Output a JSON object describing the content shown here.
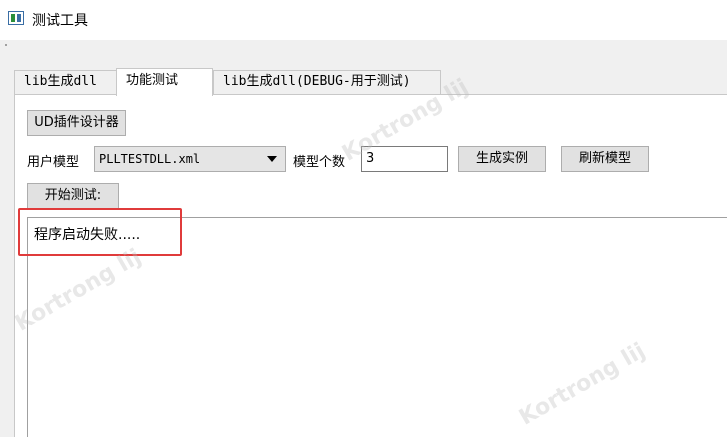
{
  "window": {
    "title": "测试工具",
    "icon": "app-window-icon"
  },
  "tabs": [
    {
      "label": "lib生成dll",
      "active": false
    },
    {
      "label": "功能测试",
      "active": true
    },
    {
      "label": "lib生成dll(DEBUG-用于测试)",
      "active": false
    }
  ],
  "toolbar": {
    "ud_designer_button": "UD插件设计器"
  },
  "model_row": {
    "user_model_label": "用户模型",
    "model_select_value": "PLLTESTDLL.xml",
    "model_count_label": "模型个数",
    "model_count_value": "3",
    "generate_button": "生成实例",
    "refresh_button": "刷新模型"
  },
  "start_test_button": "开始测试:",
  "log": {
    "text": "程序启动失败....."
  },
  "watermark": {
    "text": "Kortrong lij"
  },
  "colors": {
    "highlight": "#e03b3b",
    "panel": "#ffffff",
    "background": "#f0f0f0"
  }
}
